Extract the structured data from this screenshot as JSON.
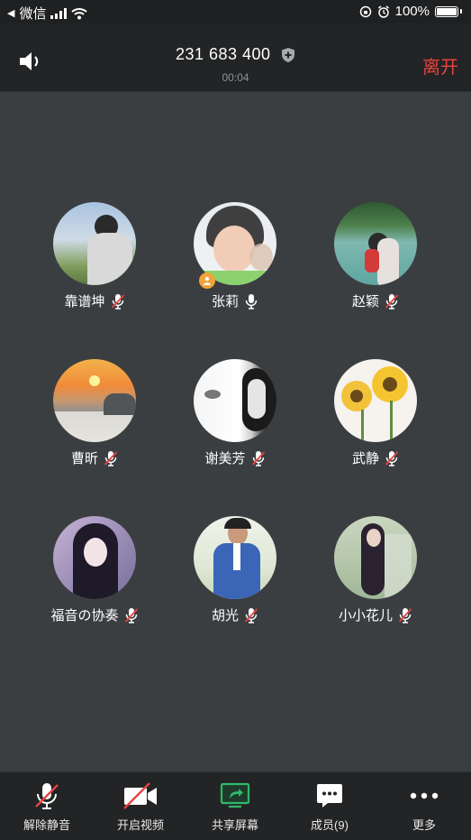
{
  "status_bar": {
    "back_app": "微信",
    "battery": "100%"
  },
  "header": {
    "meeting_id": "231 683 400",
    "timer": "00:04",
    "leave_label": "离开"
  },
  "participants": [
    {
      "name": "靠谱坤",
      "mic": "muted"
    },
    {
      "name": "张莉",
      "mic": "on",
      "host": true
    },
    {
      "name": "赵颖",
      "mic": "muted"
    },
    {
      "name": "曹昕",
      "mic": "muted"
    },
    {
      "name": "谢美芳",
      "mic": "muted"
    },
    {
      "name": "武静",
      "mic": "muted"
    },
    {
      "name": "福音の协奏",
      "mic": "muted"
    },
    {
      "name": "胡光",
      "mic": "muted"
    },
    {
      "name": "小小花儿",
      "mic": "muted"
    }
  ],
  "toolbar": {
    "unmute": "解除静音",
    "start_video": "开启视频",
    "share_screen": "共享屏幕",
    "members": "成员(9)",
    "more": "更多"
  },
  "colors": {
    "leave": "#e64340",
    "share": "#2fb86a",
    "host_badge": "#f2a33a"
  }
}
